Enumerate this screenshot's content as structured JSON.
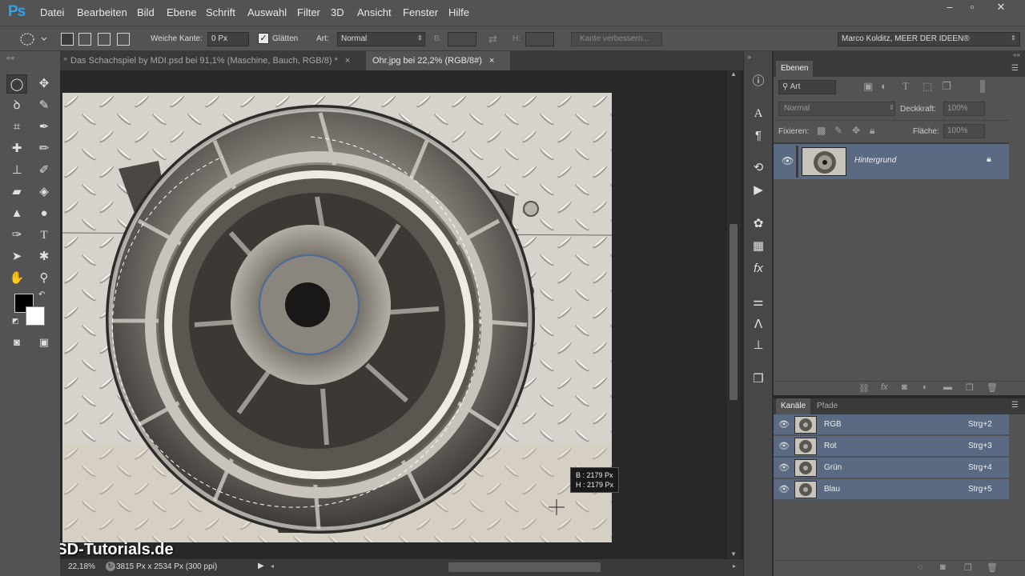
{
  "app": {
    "logo": "Ps"
  },
  "menu": [
    "Datei",
    "Bearbeiten",
    "Bild",
    "Ebene",
    "Schrift",
    "Auswahl",
    "Filter",
    "3D",
    "Ansicht",
    "Fenster",
    "Hilfe"
  ],
  "window_controls": {
    "minimize": "–",
    "restore": "▫",
    "close": "✕"
  },
  "options": {
    "feather_label": "Weiche Kante:",
    "feather_value": "0 Px",
    "antialias_label": "Glätten",
    "style_label": "Art:",
    "style_value": "Normal",
    "width_label": "B:",
    "height_label": "H:",
    "refine_edge": "Kante verbessern...",
    "workspace": "Marco Kolditz, MEER DER IDEEN®"
  },
  "doc_tabs": [
    {
      "label": "Das Schachspiel by MDI.psd bei 91,1% (Maschine, Bauch, RGB/8) *",
      "close": "×"
    },
    {
      "label": "Ohr.jpg bei 22,2% (RGB/8#)",
      "close": "×"
    }
  ],
  "canvas": {
    "size_tooltip_w": "B : 2179 Px",
    "size_tooltip_h": "H : 2179 Px"
  },
  "status": {
    "zoom": "22,18%",
    "doc_info": "3815 Px x 2534 Px (300 ppi)"
  },
  "watermark": "PSD-Tutorials.de",
  "layers_panel": {
    "tab": "Ebenen",
    "filter_kind": "Art",
    "blend_mode": "Normal",
    "opacity_label": "Deckkraft:",
    "opacity_value": "100%",
    "lock_label": "Fixieren:",
    "fill_label": "Fläche:",
    "fill_value": "100%",
    "layers": [
      {
        "name": "Hintergrund"
      }
    ]
  },
  "channels_panel": {
    "tabs": [
      "Kanäle",
      "Pfade"
    ],
    "channels": [
      {
        "name": "RGB",
        "shortcut": "Strg+2"
      },
      {
        "name": "Rot",
        "shortcut": "Strg+3"
      },
      {
        "name": "Grün",
        "shortcut": "Strg+4"
      },
      {
        "name": "Blau",
        "shortcut": "Strg+5"
      }
    ]
  },
  "colors": {
    "accent_blue": "#2ea3f2",
    "selected_row": "#596a82",
    "panel_bg": "#535353",
    "canvas_bg": "#282828"
  }
}
